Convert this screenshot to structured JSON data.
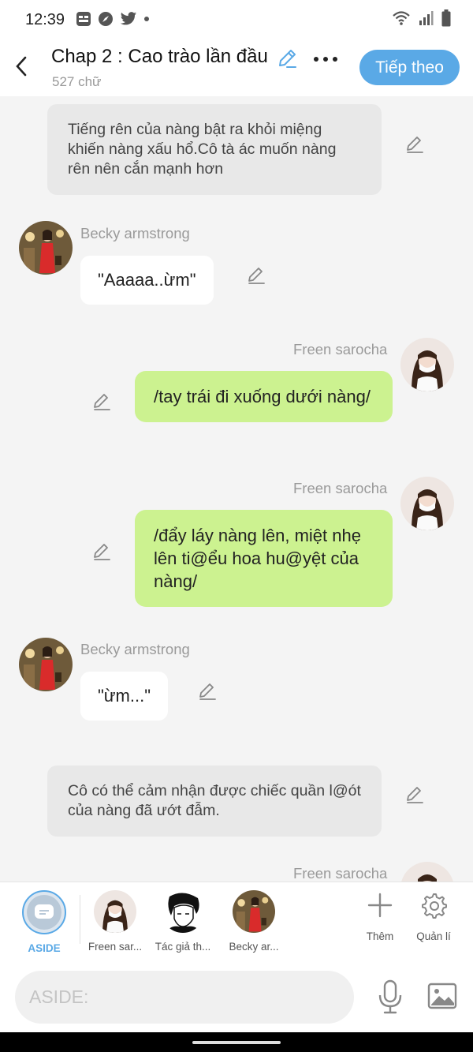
{
  "status_bar": {
    "time": "12:39",
    "left_icons": [
      "baomoi-icon",
      "compass-icon",
      "twitter-icon",
      "dot-icon"
    ],
    "right_icons": [
      "wifi-icon",
      "signal-icon",
      "battery-icon"
    ]
  },
  "header": {
    "title": "Chap 2 : Cao trào lần đầu",
    "word_count": "527 chữ",
    "next_label": "Tiếp theo"
  },
  "messages": [
    {
      "type": "aside",
      "text": "Tiếng rên của nàng bật ra khỏi miệng khiến nàng xấu hổ.Cô tà ác muốn nàng rên nên cắn mạnh hơn"
    },
    {
      "type": "left",
      "sender": "Becky armstrong",
      "text": "\"Aaaaa..ừm\""
    },
    {
      "type": "right",
      "sender": "Freen sarocha",
      "text": "/tay trái đi xuống dưới nàng/"
    },
    {
      "type": "right",
      "sender": "Freen sarocha",
      "text": "/đẩy láy nàng lên, miệt nhẹ lên ti@ểu hoa hu@yệt của nàng/"
    },
    {
      "type": "left",
      "sender": "Becky armstrong",
      "text": "\"ừm...\""
    },
    {
      "type": "aside",
      "text": "Cô có thể cảm nhận được chiếc quần l@ót của nàng đã ướt đẫm."
    },
    {
      "type": "right",
      "sender": "Freen sarocha",
      "text": ""
    }
  ],
  "characters": [
    {
      "label": "ASIDE",
      "selected": true
    },
    {
      "label": "Freen sar..."
    },
    {
      "label": "Tác giả th..."
    },
    {
      "label": "Becky ar..."
    }
  ],
  "tools": {
    "add_label": "Thêm",
    "manage_label": "Quản lí"
  },
  "input": {
    "placeholder": "ASIDE:"
  },
  "colors": {
    "accent": "#5aa9e6",
    "right_bubble": "#ccf290",
    "aside_bubble": "#e8e8e8"
  }
}
